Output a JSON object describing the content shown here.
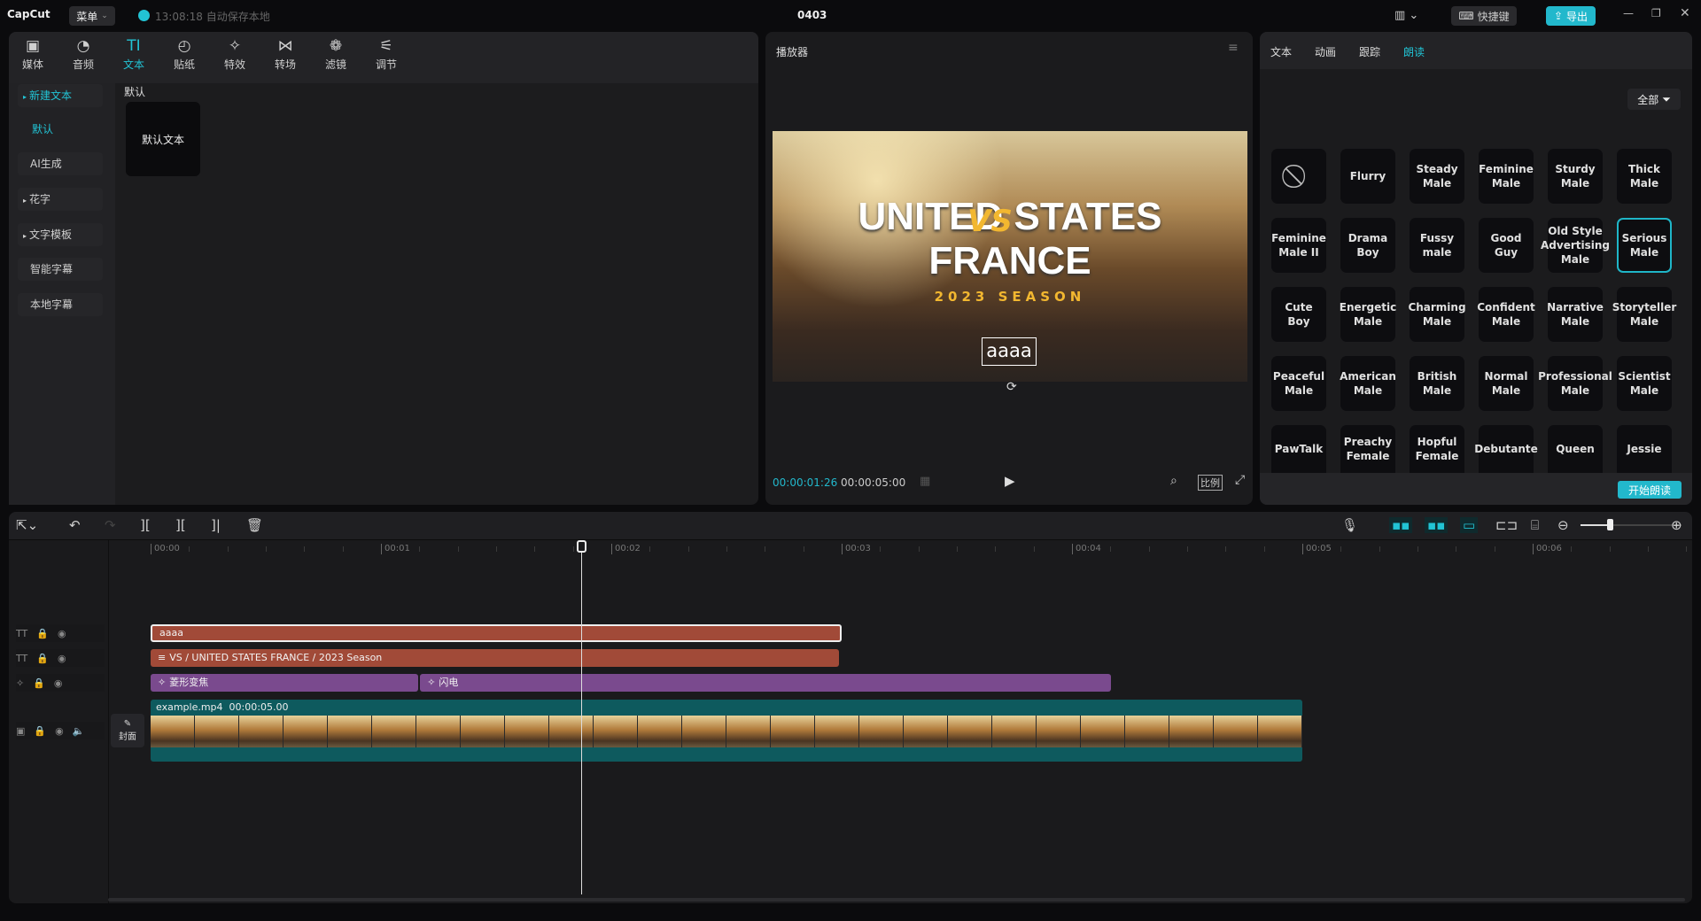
{
  "app": {
    "logo": "CapCut",
    "menu_label": "菜单",
    "autosave": "13:08:18 自动保存本地",
    "project_title": "0403",
    "shortcut_label": "快捷键",
    "export_label": "导出",
    "accent": "#22c3d4"
  },
  "tool_tabs": [
    {
      "label": "媒体",
      "icon": "media-icon"
    },
    {
      "label": "音频",
      "icon": "audio-icon"
    },
    {
      "label": "文本",
      "icon": "text-icon",
      "active": true
    },
    {
      "label": "贴纸",
      "icon": "sticker-icon"
    },
    {
      "label": "特效",
      "icon": "effects-icon"
    },
    {
      "label": "转场",
      "icon": "transition-icon"
    },
    {
      "label": "滤镜",
      "icon": "filter-icon"
    },
    {
      "label": "调节",
      "icon": "adjust-icon"
    }
  ],
  "text_sidebar": [
    {
      "label": "新建文本",
      "active": true
    },
    {
      "label": "默认"
    },
    {
      "label": "AI生成"
    },
    {
      "label": "花字"
    },
    {
      "label": "文字模板"
    },
    {
      "label": "智能字幕"
    },
    {
      "label": "本地字幕"
    }
  ],
  "text_content": {
    "section": "默认",
    "item": "默认文本"
  },
  "player": {
    "title": "播放器",
    "overlay_title1": "UNITED STATES",
    "overlay_vs": "VS",
    "overlay_title2": "FRANCE",
    "overlay_season": "2023 SEASON",
    "selected_text": "aaaa",
    "current_time": "00:00:01:26",
    "total_time": "00:00:05:00",
    "ratio_label": "比例"
  },
  "right_panel": {
    "tabs": [
      {
        "label": "文本"
      },
      {
        "label": "动画"
      },
      {
        "label": "跟踪"
      },
      {
        "label": "朗读",
        "active": true
      }
    ],
    "filter_label": "全部",
    "start_button": "开始朗读",
    "voices": [
      "",
      "Flurry",
      "Steady Male",
      "Feminine Male",
      "Sturdy Male",
      "Thick Male",
      "Feminine Male II",
      "Drama Boy",
      "Fussy male",
      "Good Guy",
      "Old Style Advertising Male",
      "Serious Male",
      "Cute Boy",
      "Energetic Male",
      "Charming Male",
      "Confident Male",
      "Narrative Male",
      "Storyteller Male",
      "Peaceful Male",
      "American Male",
      "British Male",
      "Normal Male",
      "Professional Male",
      "Scientist Male",
      "PawTalk",
      "Preachy Female",
      "Hopful Female",
      "Debutante",
      "Queen",
      "Jessie"
    ],
    "selected_voice": "Serious Male"
  },
  "timeline": {
    "ruler": [
      "00:00",
      "00:01",
      "00:02",
      "00:03",
      "00:04",
      "00:05",
      "00:06"
    ],
    "playhead_seconds": 1.87,
    "cover_label": "封面",
    "clips": {
      "text1": {
        "label": "aaaa",
        "start": 0,
        "end": 3.0
      },
      "text2": {
        "label": "VS / UNITED STATES FRANCE / 2023 Season",
        "start": 0,
        "end": 2.99
      },
      "effect1": {
        "label": "菱形变焦",
        "start": 0,
        "end": 1.16
      },
      "effect2": {
        "label": "闪电",
        "start": 1.17,
        "end": 4.17
      },
      "video": {
        "label": "example.mp4",
        "duration": "00:00:05.00",
        "start": 0,
        "end": 5.0
      }
    },
    "colors": {
      "text": "#a14a38",
      "effect": "#7a4a8e",
      "video": "#0e5a5e"
    }
  }
}
